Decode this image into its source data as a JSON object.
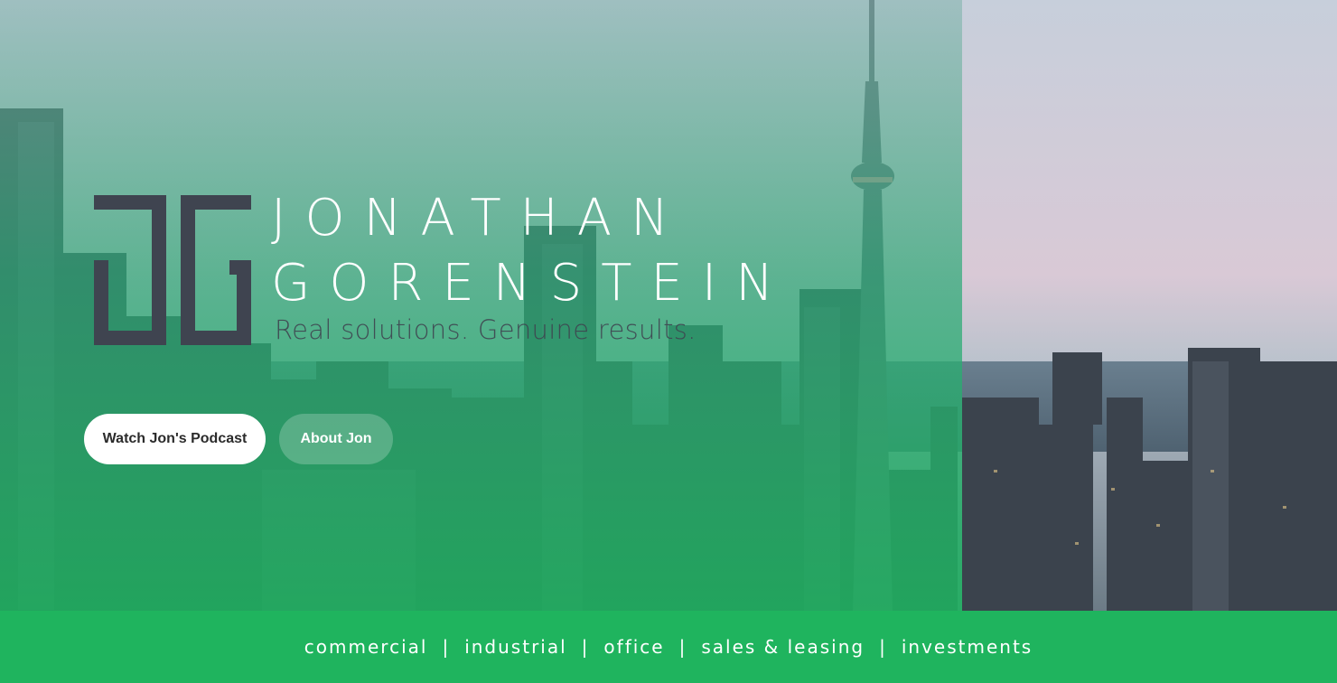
{
  "brand": {
    "logo_icon": "jg-monogram-icon",
    "name_line1": "JONATHAN",
    "name_line2": "GORENSTEIN",
    "tagline": "Real solutions. Genuine results."
  },
  "hero": {
    "background": "toronto-skyline-photo",
    "buttons": {
      "podcast": "Watch Jon's Podcast",
      "about": "About Jon"
    }
  },
  "services": {
    "items": [
      "commercial",
      "industrial",
      "office",
      "sales & leasing",
      "investments"
    ],
    "separator": "|"
  },
  "colors": {
    "accent_green": "#1fb45e",
    "logo_dark": "#3f4450",
    "white": "#ffffff"
  }
}
